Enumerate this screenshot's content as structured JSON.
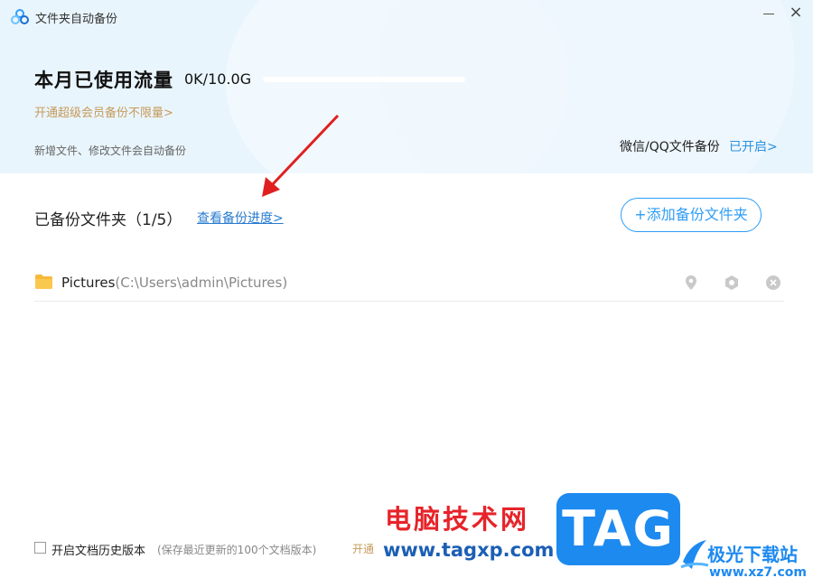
{
  "window": {
    "title": "文件夹自动备份",
    "minimize_icon": "minimize-icon",
    "close_icon": "close-icon",
    "close_glyph": "×"
  },
  "usage": {
    "label": "本月已使用流量",
    "value": "0K/10.0G",
    "used_fraction": 0.0,
    "vip_link": "开通超级会员备份不限量>",
    "auto_note": "新增文件、修改文件会自动备份"
  },
  "wechat_backup": {
    "label": "微信/QQ文件备份",
    "status": "已开启>"
  },
  "backed_up": {
    "title": "已备份文件夹（1/5）",
    "progress_link": "查看备份进度>",
    "add_button": "+添加备份文件夹",
    "folders": [
      {
        "name": "Pictures",
        "path": "(C:\\Users\\admin\\Pictures)",
        "icon": "folder-icon",
        "actions": [
          "location-icon",
          "settings-icon",
          "delete-icon"
        ]
      }
    ]
  },
  "footer": {
    "history_checked": false,
    "history_label": "开启文档历史版本",
    "history_note": "(保存最近更新的100个文档版本)",
    "vip_link": "开通"
  },
  "watermarks": {
    "site_name": "电脑技术网",
    "site_url": "www.tagxp.com",
    "tag_logo": "TAG",
    "download_site": "极光下载站",
    "download_url": "www.xz7.com"
  },
  "colors": {
    "accent": "#2f9df7",
    "header_bg": "#e9f5fc",
    "vip_gold": "#c69a5a",
    "link_blue": "#2a7ccf",
    "arrow_red": "#e02020"
  }
}
